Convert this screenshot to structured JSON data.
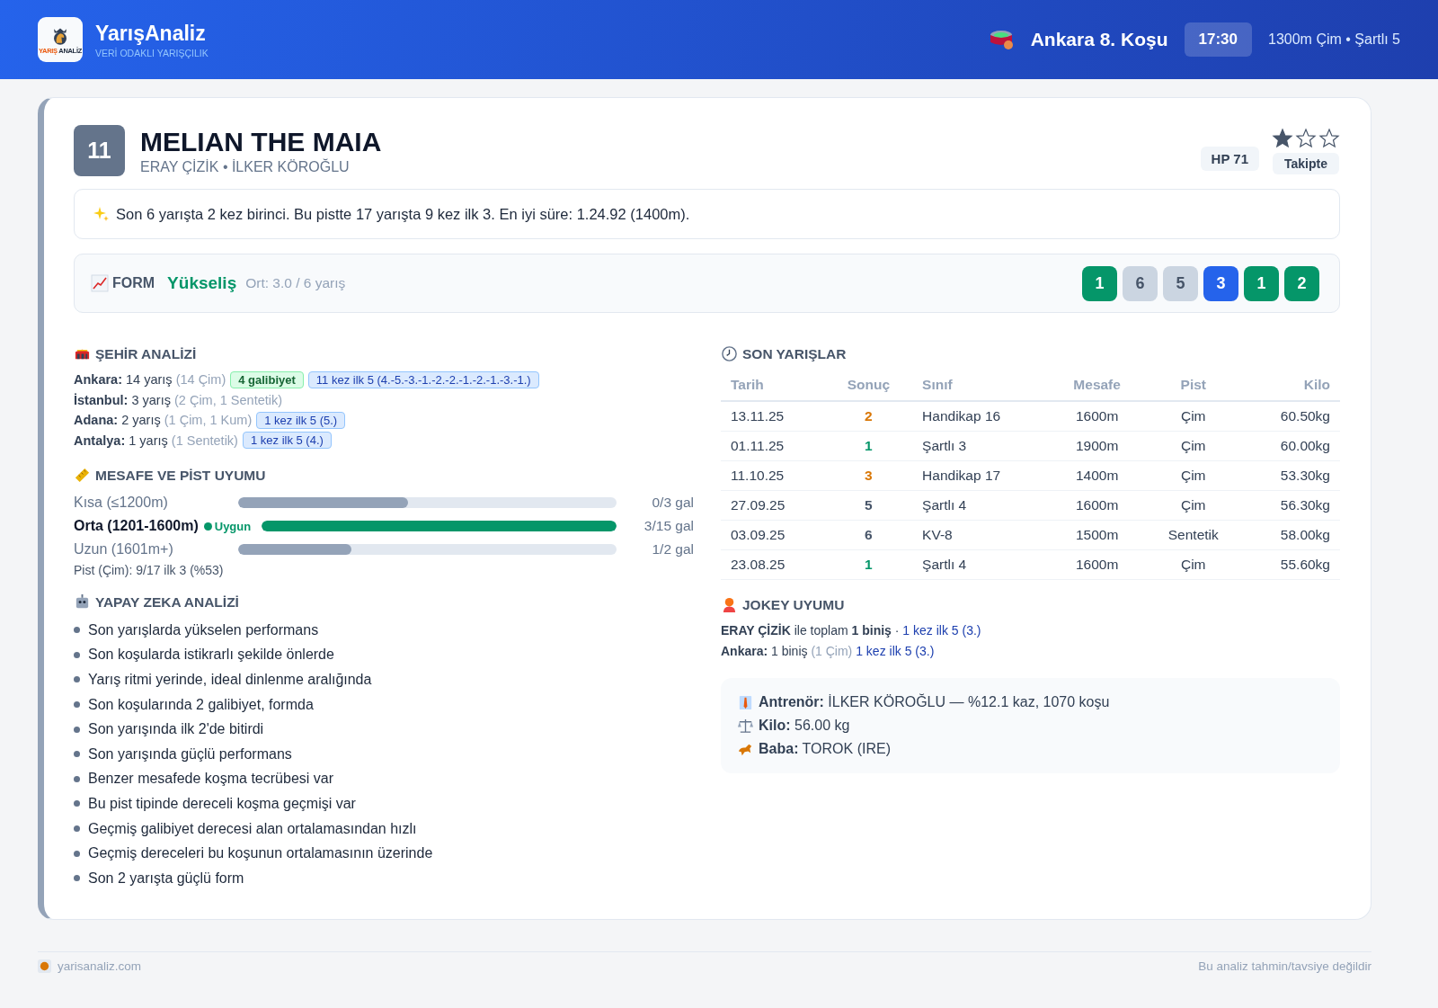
{
  "header": {
    "logo_text": [
      "YARIŞ",
      "ANALİZ"
    ],
    "brand": "YarışAnaliz",
    "tagline": "VERİ ODAKLI YARIŞÇILIK",
    "race_title": "Ankara 8. Koşu",
    "time": "17:30",
    "race_info": "1300m Çim • Şartlı 5"
  },
  "horse": {
    "number": "11",
    "name": "MELIAN THE MAIA",
    "subtitle": "ERAY ÇİZİK • İLKER KÖROĞLU",
    "rating": "HP 71",
    "stars": 1,
    "status": "Takipte"
  },
  "summary": "Son 6 yarışta 2 kez birinci. Bu pistte 17 yarışta 9 kez ilk 3. En iyi süre: 1.24.92 (1400m).",
  "form": {
    "label": "FORM",
    "trend": "Yükseliş",
    "average": "Ort: 3.0 / 6 yarış",
    "results": [
      {
        "text": "1",
        "kind": "top2"
      },
      {
        "text": "6",
        "kind": "out"
      },
      {
        "text": "5",
        "kind": "out"
      },
      {
        "text": "3",
        "kind": "top3"
      },
      {
        "text": "1",
        "kind": "top2"
      },
      {
        "text": "2",
        "kind": "top2"
      }
    ]
  },
  "city_analysis": {
    "title": "ŞEHİR ANALİZİ",
    "rows": [
      {
        "city": "Ankara:",
        "count": "14 yarış",
        "detail": "(14 Çim)",
        "tags": [
          {
            "kind": "win",
            "text": "4 galibiyet"
          },
          {
            "kind": "top5",
            "text": "11 kez ilk 5 (4.-5.-3.-1.-2.-2.-1.-2.-1.-3.-1.)"
          }
        ]
      },
      {
        "city": "İstanbul:",
        "count": "3 yarış",
        "detail": "(2 Çim, 1 Sentetik)",
        "tags": []
      },
      {
        "city": "Adana:",
        "count": "2 yarış",
        "detail": "(1 Çim, 1 Kum)",
        "tags": [
          {
            "kind": "top5",
            "text": "1 kez ilk 5 (5.)"
          }
        ]
      },
      {
        "city": "Antalya:",
        "count": "1 yarış",
        "detail": "(1 Sentetik)",
        "tags": [
          {
            "kind": "top5",
            "text": "1 kez ilk 5 (4.)"
          }
        ]
      }
    ]
  },
  "distance_fit": {
    "title": "MESAFE VE PİST UYUMU",
    "rows": [
      {
        "label": "Kısa (≤1200m)",
        "suitable": false,
        "level": 0.45,
        "reading": "0/3 gal"
      },
      {
        "label": "Orta (1201-1600m)",
        "suitable": true,
        "badge": "Uygun",
        "level": 1.0,
        "reading": "3/15 gal"
      },
      {
        "label": "Uzun (1601m+)",
        "suitable": false,
        "level": 0.3,
        "reading": "1/2 gal"
      }
    ],
    "track_note": "Pist (Çim): 9/17 ilk 3 (%53)"
  },
  "ai_analysis": {
    "title": "YAPAY ZEKA ANALİZİ",
    "items": [
      "Son yarışlarda yükselen performans",
      "Son koşularda istikrarlı şekilde önlerde",
      "Yarış ritmi yerinde, ideal dinlenme aralığında",
      "Son koşularında 2 galibiyet, formda",
      "Son yarışında ilk 2'de bitirdi",
      "Son yarışında güçlü performans",
      "Benzer mesafede koşma tecrübesi var",
      "Bu pist tipinde dereceli koşma geçmişi var",
      "Geçmiş galibiyet derecesi alan ortalamasından hızlı",
      "Geçmiş dereceleri bu koşunun ortalamasının üzerinde",
      "Son 2 yarışta güçlü form"
    ]
  },
  "recent_races": {
    "title": "SON YARIŞLAR",
    "columns": [
      "Tarih",
      "Sonuç",
      "Sınıf",
      "Mesafe",
      "Pist",
      "Kilo"
    ],
    "rows": [
      {
        "date": "13.11.25",
        "result": "2",
        "kind": "place",
        "class": "Handikap 16",
        "distance": "1600m",
        "track": "Çim",
        "weight": "60.50kg"
      },
      {
        "date": "01.11.25",
        "result": "1",
        "kind": "win",
        "class": "Şartlı 3",
        "distance": "1900m",
        "track": "Çim",
        "weight": "60.00kg"
      },
      {
        "date": "11.10.25",
        "result": "3",
        "kind": "place",
        "class": "Handikap 17",
        "distance": "1400m",
        "track": "Çim",
        "weight": "53.30kg"
      },
      {
        "date": "27.09.25",
        "result": "5",
        "kind": "out",
        "class": "Şartlı 4",
        "distance": "1600m",
        "track": "Çim",
        "weight": "56.30kg"
      },
      {
        "date": "03.09.25",
        "result": "6",
        "kind": "out",
        "class": "KV-8",
        "distance": "1500m",
        "track": "Sentetik",
        "weight": "58.00kg"
      },
      {
        "date": "23.08.25",
        "result": "1",
        "kind": "win",
        "class": "Şartlı 4",
        "distance": "1600m",
        "track": "Çim",
        "weight": "55.60kg"
      }
    ]
  },
  "jockey_fit": {
    "title": "JOKEY UYUMU",
    "lines": [
      {
        "lead": "ERAY ÇİZİK",
        "text": "ile toplam **1 biniş** ·",
        "highlight": "1 kez ilk 5 (3.)"
      },
      {
        "lead": "Ankara:",
        "text": "1 biniş",
        "muted": "(1 Çim)",
        "highlight": "1 kez ilk 5 (3.)"
      }
    ]
  },
  "info": [
    {
      "kind": "trainer",
      "label": "Antrenör:",
      "value": "İLKER KÖROĞLU — %12.1 kaz, 1070 koşu"
    },
    {
      "kind": "weight",
      "label": "Kilo:",
      "value": "56.00 kg"
    },
    {
      "kind": "sire",
      "label": "Baba:",
      "value": "TOROK (IRE)"
    }
  ],
  "footer": {
    "site": "yarisanaliz.com",
    "disclaimer": "Bu analiz tahmin/tavsiye değildir"
  }
}
